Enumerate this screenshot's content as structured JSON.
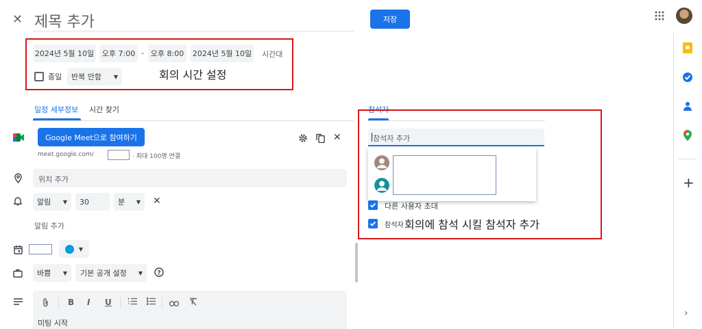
{
  "header": {
    "close_glyph": "✕",
    "title_placeholder": "제목 추가",
    "save_label": "저장"
  },
  "time_row": {
    "start_date": "2024년 5월 10일",
    "start_time": "오후 7:00",
    "dash": "-",
    "end_time": "오후 8:00",
    "end_date": "2024년 5월 10일",
    "timezone": "시간대",
    "allday_label": "종일",
    "repeat_label": "반복 안함"
  },
  "annotations": {
    "time_setting": "회의 시간 설정",
    "guest_setting": "회의에 참석 시킬 참석자 추가"
  },
  "tabs": {
    "details": "일정 세부정보",
    "find_time": "시간 찾기"
  },
  "meet": {
    "button_label": "Google Meet으로 참여하기",
    "link_prefix": "meet.google.com/",
    "limit_text": "· 최대 100명 연결"
  },
  "location_placeholder": "위치 추가",
  "notification": {
    "type": "알림",
    "value": "30",
    "unit": "분",
    "add_label": "알림 추가"
  },
  "busy": {
    "status": "바쁨",
    "visibility": "기본 공개 설정"
  },
  "description_text": "미팅 시작",
  "guests": {
    "tab_label": "참석자",
    "input_placeholder": "참석자 추가",
    "invite_others": "다른 사용자 초대",
    "see_list": "참석자 목록 보기"
  },
  "colors": {
    "accent": "#1a73e8",
    "annotation_red": "#d41616",
    "event_color": "#039be5"
  }
}
